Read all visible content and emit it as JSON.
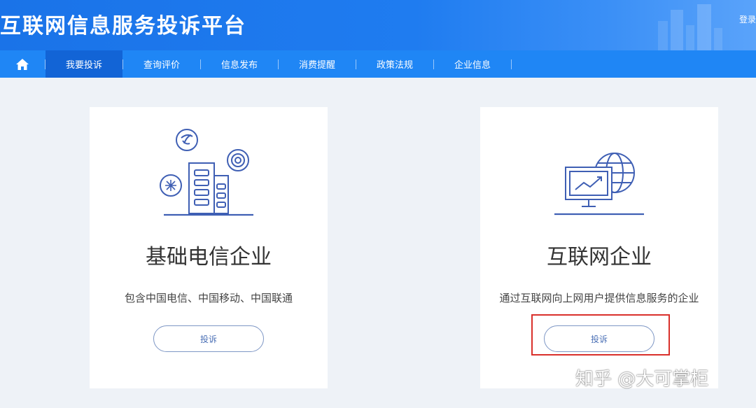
{
  "header": {
    "title": "互联网信息服务投诉平台",
    "login": "登录"
  },
  "nav": {
    "home_icon": "home-icon",
    "items": [
      {
        "label": "我要投诉",
        "active": true
      },
      {
        "label": "查询评价"
      },
      {
        "label": "信息发布"
      },
      {
        "label": "消费提醒"
      },
      {
        "label": "政策法规"
      },
      {
        "label": "企业信息"
      }
    ]
  },
  "cards": [
    {
      "icon": "telecom-building-icon",
      "heading": "基础电信企业",
      "description": "包含中国电信、中国移动、中国联通",
      "button": "投诉"
    },
    {
      "icon": "internet-monitor-globe-icon",
      "heading": "互联网企业",
      "description": "通过互联网向上网用户提供信息服务的企业",
      "button": "投诉"
    }
  ],
  "watermark": "知乎 @大可掌柜",
  "colors": {
    "header_blue": "#1a73e8",
    "nav_blue": "#1f86f5",
    "nav_active": "#1264d6",
    "highlight_red": "#d9302b",
    "button_border": "#7e97c5"
  }
}
